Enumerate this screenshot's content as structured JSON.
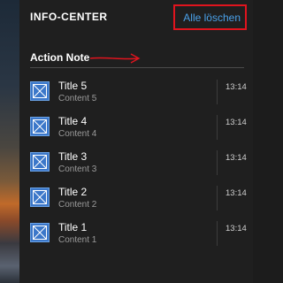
{
  "header": {
    "title": "INFO-CENTER",
    "clear_all_label": "Alle löschen"
  },
  "group": {
    "title": "Action Note"
  },
  "notifications": [
    {
      "title": "Title 5",
      "content": "Content 5",
      "time": "13:14",
      "icon": "app-tile-icon"
    },
    {
      "title": "Title 4",
      "content": "Content 4",
      "time": "13:14",
      "icon": "app-tile-icon"
    },
    {
      "title": "Title 3",
      "content": "Content 3",
      "time": "13:14",
      "icon": "app-tile-icon"
    },
    {
      "title": "Title 2",
      "content": "Content 2",
      "time": "13:14",
      "icon": "app-tile-icon"
    },
    {
      "title": "Title 1",
      "content": "Content 1",
      "time": "13:14",
      "icon": "app-tile-icon"
    }
  ],
  "colors": {
    "accent": "#4aa0e8",
    "highlight_box": "#e0141e",
    "panel_bg": "#1f1f1f",
    "icon_tile": "#3b77c9"
  }
}
